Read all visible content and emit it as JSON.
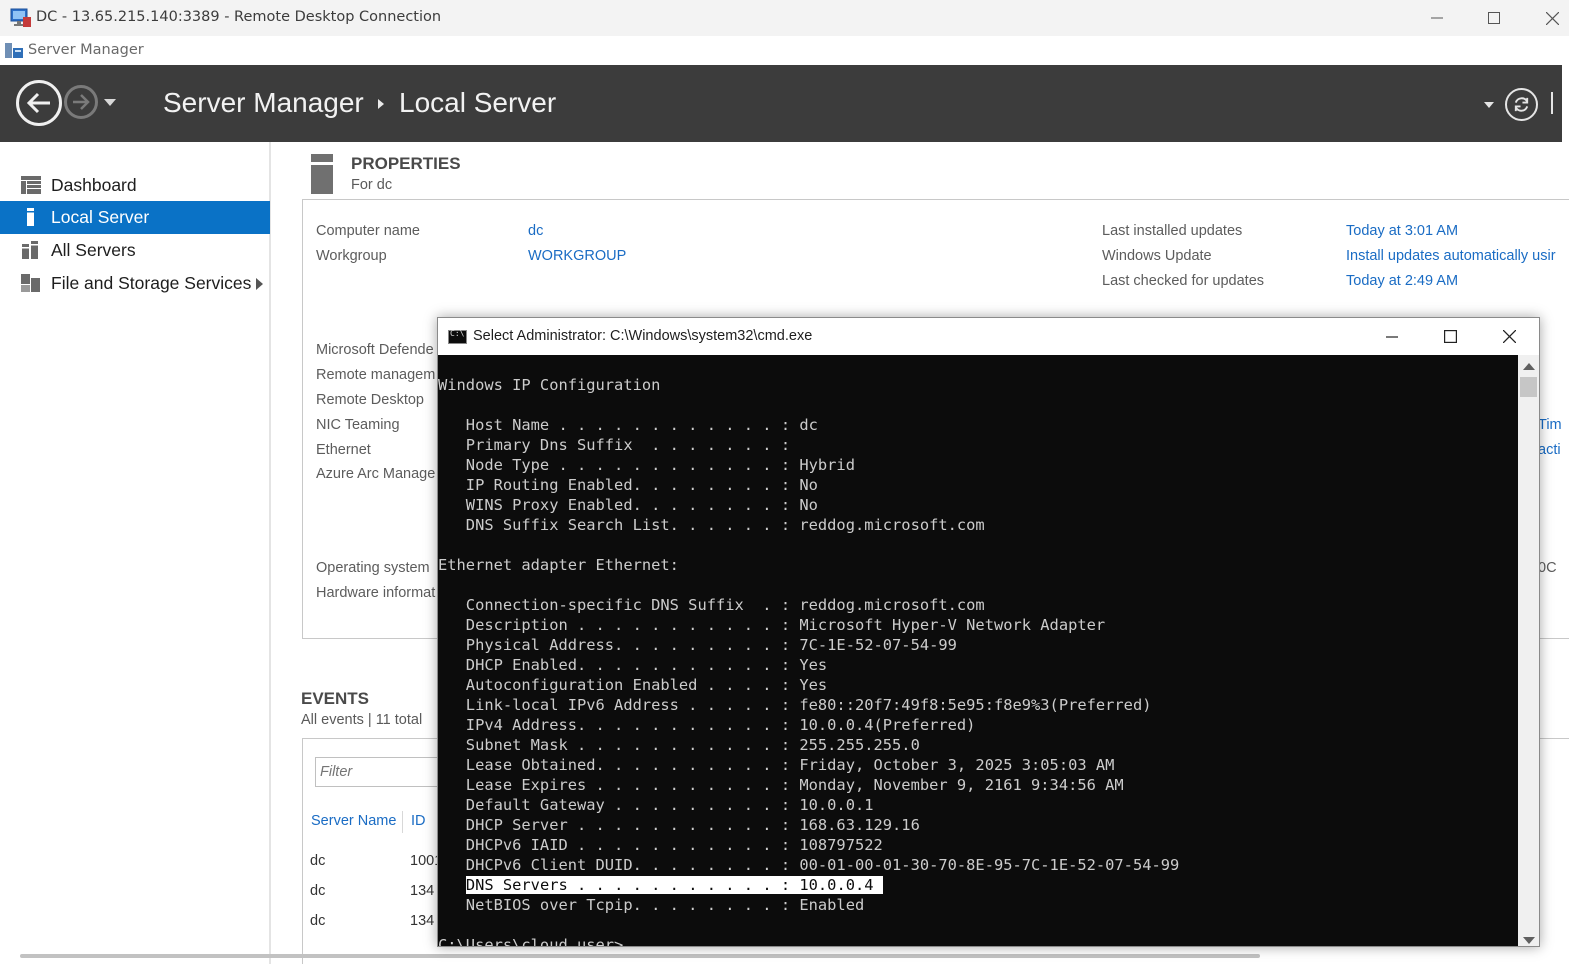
{
  "rdp": {
    "title": "DC - 13.65.215.140:3389 - Remote Desktop Connection"
  },
  "sm": {
    "window_title": "Server Manager",
    "breadcrumb": {
      "root": "Server Manager",
      "page": "Local Server"
    },
    "sidebar": {
      "items": [
        {
          "label": "Dashboard"
        },
        {
          "label": "Local Server"
        },
        {
          "label": "All Servers"
        },
        {
          "label": "File and Storage Services"
        }
      ]
    },
    "properties": {
      "title": "PROPERTIES",
      "subtitle": "For dc",
      "computer_name_label": "Computer name",
      "computer_name_value": "dc",
      "workgroup_label": "Workgroup",
      "workgroup_value": "WORKGROUP",
      "last_installed_label": "Last installed updates",
      "last_installed_value": "Today at 3:01 AM",
      "windows_update_label": "Windows Update",
      "windows_update_value": "Install updates automatically usir",
      "last_checked_label": "Last checked for updates",
      "last_checked_value": "Today at 2:49 AM",
      "defender_label": "Microsoft Defende",
      "remote_mgmt_label": "Remote managem",
      "remote_desktop_label": "Remote Desktop",
      "nic_teaming_label": "NIC Teaming",
      "ethernet_label": "Ethernet",
      "azure_arc_label": "Azure Arc Manage",
      "os_label": "Operating system",
      "hardware_label": "Hardware informat",
      "right_partial_1": "Tim",
      "right_partial_2": "acti",
      "right_partial_3": "0C"
    },
    "events": {
      "title": "EVENTS",
      "subtitle": "All events | 11 total",
      "filter_placeholder": "Filter",
      "columns": [
        "Server Name",
        "ID"
      ],
      "rows": [
        {
          "server": "dc",
          "id": "1001"
        },
        {
          "server": "dc",
          "id": "134"
        },
        {
          "server": "dc",
          "id": "134"
        }
      ]
    }
  },
  "cmd": {
    "title": "Select Administrator: C:\\Windows\\system32\\cmd.exe",
    "icon_text": "C:\\",
    "lines": [
      "Windows IP Configuration",
      "",
      "   Host Name . . . . . . . . . . . . : dc",
      "   Primary Dns Suffix  . . . . . . . :",
      "   Node Type . . . . . . . . . . . . : Hybrid",
      "   IP Routing Enabled. . . . . . . . : No",
      "   WINS Proxy Enabled. . . . . . . . : No",
      "   DNS Suffix Search List. . . . . . : reddog.microsoft.com",
      "",
      "Ethernet adapter Ethernet:",
      "",
      "   Connection-specific DNS Suffix  . : reddog.microsoft.com",
      "   Description . . . . . . . . . . . : Microsoft Hyper-V Network Adapter",
      "   Physical Address. . . . . . . . . : 7C-1E-52-07-54-99",
      "   DHCP Enabled. . . . . . . . . . . : Yes",
      "   Autoconfiguration Enabled . . . . : Yes",
      "   Link-local IPv6 Address . . . . . : fe80::20f7:49f8:5e95:f8e9%3(Preferred)",
      "   IPv4 Address. . . . . . . . . . . : 10.0.0.4(Preferred)",
      "   Subnet Mask . . . . . . . . . . . : 255.255.255.0",
      "   Lease Obtained. . . . . . . . . . : Friday, October 3, 2025 3:05:03 AM",
      "   Lease Expires . . . . . . . . . . : Monday, November 9, 2161 9:34:56 AM",
      "   Default Gateway . . . . . . . . . : 10.0.0.1",
      "   DHCP Server . . . . . . . . . . . : 168.63.129.16",
      "   DHCPv6 IAID . . . . . . . . . . . : 108797522",
      "   DHCPv6 Client DUID. . . . . . . . : 00-01-00-01-30-70-8E-95-7C-1E-52-07-54-99"
    ],
    "selected_prefix": "   ",
    "selected_line": "DNS Servers . . . . . . . . . . . : 10.0.0.4 ",
    "after_lines": [
      "   NetBIOS over Tcpip. . . . . . . . : Enabled",
      "",
      "C:\\Users\\cloud_user>"
    ]
  },
  "colors": {
    "accent": "#0a72c6",
    "link": "#1a6cc4",
    "header_bg": "#3c3c3c",
    "console_bg": "#0c0c0c",
    "console_fg": "#cccccc"
  },
  "icons": {
    "rdp": "remote-desktop-icon",
    "back": "back-arrow-icon",
    "forward": "forward-arrow-icon",
    "refresh": "refresh-icon",
    "dashboard": "dashboard-grid-icon",
    "local_server": "server-icon",
    "all_servers": "servers-icon",
    "storage": "storage-icon"
  }
}
